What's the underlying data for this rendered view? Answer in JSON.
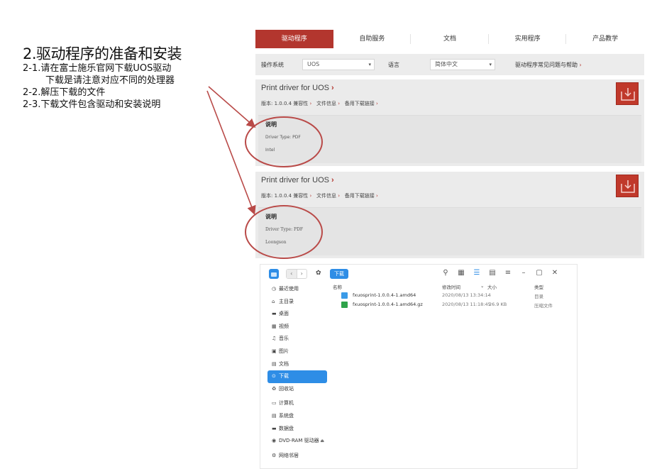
{
  "instructions": {
    "title": "2.驱动程序的准备和安装",
    "line1": "2-1.请在富士施乐官网下载UOS驱动",
    "line1b": "下载是请注意对应不同的处理器",
    "line2": "2-2.解压下载的文件",
    "line3": "2-3.下载文件包含驱动和安装说明"
  },
  "web": {
    "tabs": [
      "驱动程序",
      "自助服务",
      "文档",
      "实用程序",
      "产品教学"
    ],
    "active_tab": 0,
    "filter": {
      "os_label": "操作系统",
      "os_value": "UOS",
      "lang_label": "语言",
      "lang_value": "简体中文",
      "help_link": "驱动程序常见问题与帮助",
      "help_arrow": "›"
    },
    "cards": [
      {
        "title": "Print driver for UOS",
        "title_arrow": "›",
        "meta": "版本: 1.0.0.4   兼容性",
        "meta_info": "文件信息",
        "meta_backup": "备用下载链接",
        "arrow": "›",
        "desc_heading": "说明",
        "desc_line1": "Driver Type: PDF",
        "desc_line2": "Intel"
      },
      {
        "title": "Print driver for UOS",
        "title_arrow": "›",
        "meta": "版本: 1.0.0.4   兼容性",
        "meta_info": "文件信息",
        "meta_backup": "备用下载链接",
        "arrow": "›",
        "desc_heading": "说明",
        "desc_line1": "Driver Type: PDF",
        "desc_line2": "Loongson"
      }
    ],
    "accent_color": "#b3362e"
  },
  "file_manager": {
    "current_folder": "下载",
    "sidebar": [
      {
        "icon": "◷",
        "label": "最近使用"
      },
      {
        "icon": "⌂",
        "label": "主目录"
      },
      {
        "icon": "▬",
        "label": "桌面"
      },
      {
        "icon": "▦",
        "label": "视频"
      },
      {
        "icon": "♫",
        "label": "音乐"
      },
      {
        "icon": "▣",
        "label": "图片"
      },
      {
        "icon": "▤",
        "label": "文档"
      },
      {
        "icon": "⊙",
        "label": "下载"
      },
      {
        "icon": "♻",
        "label": "回收站"
      },
      {
        "icon": "▭",
        "label": "计算机"
      },
      {
        "icon": "▤",
        "label": "系统盘"
      },
      {
        "icon": "▬",
        "label": "数据盘"
      },
      {
        "icon": "◉",
        "label": "DVD-RAM 驱动器"
      },
      {
        "icon": "⚙",
        "label": "网络邻居"
      }
    ],
    "active_sidebar": 7,
    "columns": {
      "name": "名称",
      "modified": "修改时间",
      "size": "大小",
      "type": "类型"
    },
    "files": [
      {
        "name": "fxuosprint-1.0.0.4-1.amd64",
        "modified": "2020/08/13 13:34:14",
        "size": "-",
        "type": "目录",
        "icon": "folder-icon"
      },
      {
        "name": "fxuosprint-1.0.0.4-1.amd64.gz",
        "modified": "2020/08/13 11:18:45",
        "size": "26.9 KB",
        "type": "压缩文件",
        "icon": "archive-icon"
      }
    ],
    "accent_color": "#2e8de6"
  }
}
